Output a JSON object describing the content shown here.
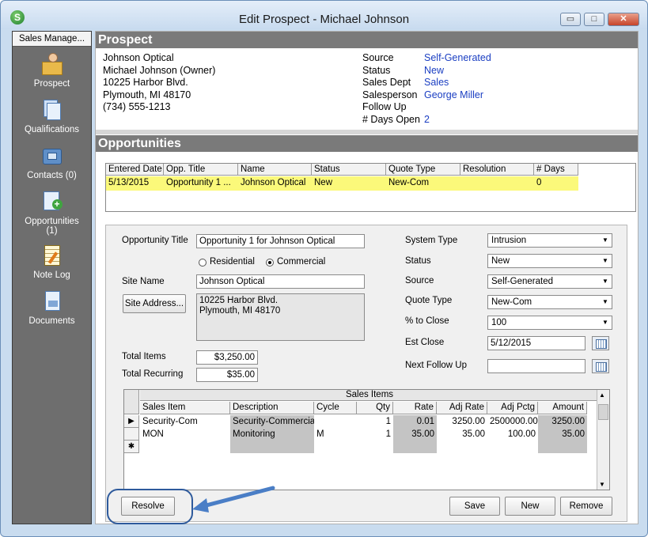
{
  "window": {
    "title": "Edit Prospect - Michael Johnson",
    "app_icon": "S",
    "minimize": "▭",
    "maximize": "□",
    "close": "✕"
  },
  "nav": {
    "header": "Sales Manage...",
    "items": [
      {
        "label": "Prospect",
        "icon": "person-folder-icon"
      },
      {
        "label": "Qualifications",
        "icon": "document-stack-icon"
      },
      {
        "label": "Contacts (0)",
        "icon": "phone-icon"
      },
      {
        "label": "Opportunities",
        "sub": "(1)",
        "icon": "add-document-icon"
      },
      {
        "label": "Note Log",
        "icon": "notepad-icon"
      },
      {
        "label": "Documents",
        "icon": "document-icon"
      }
    ]
  },
  "prospect": {
    "header": "Prospect",
    "company": "Johnson Optical",
    "contact": "Michael Johnson  (Owner)",
    "address1": "10225 Harbor Blvd.",
    "address2": "Plymouth, MI 48170",
    "phone": "(734) 555-1213",
    "fields": [
      {
        "label": "Source",
        "value": "Self-Generated"
      },
      {
        "label": "Status",
        "value": "New"
      },
      {
        "label": "Sales Dept",
        "value": "Sales"
      },
      {
        "label": "Salesperson",
        "value": "George Miller"
      },
      {
        "label": "Follow Up",
        "value": ""
      },
      {
        "label": "# Days Open",
        "value": "2"
      }
    ]
  },
  "opportunities": {
    "header": "Opportunities",
    "columns": [
      "Entered Date",
      "Opp. Title",
      "Name",
      "Status",
      "Quote Type",
      "Resolution",
      "# Days"
    ],
    "rows": [
      [
        "5/13/2015",
        "Opportunity 1 ...",
        "Johnson Optical",
        "New",
        "New-Com",
        "",
        "0"
      ]
    ]
  },
  "detail": {
    "opp_title_label": "Opportunity Title",
    "opp_title_value": "Opportunity 1 for Johnson Optical",
    "radio_residential": "Residential",
    "radio_commercial": "Commercial",
    "site_name_label": "Site Name",
    "site_name_value": "Johnson Optical",
    "site_address_button": "Site Address...",
    "site_address_line1": "10225 Harbor Blvd.",
    "site_address_line2": "Plymouth, MI  48170",
    "total_items_label": "Total Items",
    "total_items_value": "$3,250.00",
    "total_recurring_label": "Total Recurring",
    "total_recurring_value": "$35.00",
    "system_type_label": "System Type",
    "system_type_value": "Intrusion",
    "status_label": "Status",
    "status_value": "New",
    "source_label": "Source",
    "source_value": "Self-Generated",
    "quote_type_label": "Quote Type",
    "quote_type_value": "New-Com",
    "pct_close_label": "% to Close",
    "pct_close_value": "100",
    "est_close_label": "Est Close",
    "est_close_value": "5/12/2015",
    "next_follow_label": "Next Follow Up",
    "next_follow_value": ""
  },
  "sales_items": {
    "title": "Sales Items",
    "columns": [
      "Sales Item",
      "Description",
      "Cycle",
      "Qty",
      "Rate",
      "Adj Rate",
      "Adj Pctg",
      "Amount"
    ],
    "rows": [
      [
        "Security-Com",
        "Security-Commercial",
        "",
        "1",
        "0.01",
        "3250.00",
        "2500000.00",
        "3250.00"
      ],
      [
        "MON",
        "Monitoring",
        "M",
        "1",
        "35.00",
        "35.00",
        "100.00",
        "35.00"
      ]
    ],
    "current_row_marker": "▶",
    "new_row_marker": "✱"
  },
  "buttons": {
    "resolve": "Resolve",
    "save": "Save",
    "new": "New",
    "remove": "Remove"
  },
  "colors": {
    "highlight_row": "#fbf97a",
    "annotation": "#2e5a9c",
    "link_value": "#1a3ec2"
  }
}
